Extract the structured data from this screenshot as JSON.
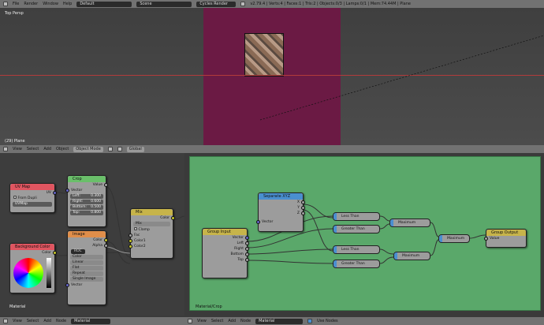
{
  "info_bar": {
    "menus": [
      "File",
      "Render",
      "Window",
      "Help"
    ],
    "layout": "Default",
    "scene": "Scene",
    "engine": "Cycles Render",
    "stats": "v2.79.4 | Verts:4 | Faces:1 | Tris:2 | Objects:0/3 | Lamps:0/1 | Mem:74.44M | Plane"
  },
  "viewport": {
    "view_label": "Top Persp",
    "object_label": "(29) Plane"
  },
  "view3d_header": {
    "menus": [
      "View",
      "Select",
      "Add",
      "Object"
    ],
    "mode": "Object Mode",
    "orientation": "Global"
  },
  "left_editor": {
    "footer": "Material",
    "uvmap": {
      "title": "UV Map",
      "out": "UV",
      "from_dupli": "From Dupli",
      "map": "UVMap"
    },
    "crop": {
      "title": "Crop",
      "out": "Value",
      "vector": "Vector",
      "fields": [
        {
          "k": "Left:",
          "v": "0.300"
        },
        {
          "k": "Right:",
          "v": "0.600"
        },
        {
          "k": "Bottom:",
          "v": "0.500"
        },
        {
          "k": "Top:",
          "v": "0.800"
        }
      ]
    },
    "image": {
      "title": "Image",
      "color": "Color",
      "alpha": "Alpha",
      "img": "ROC",
      "opts": [
        "Color",
        "Linear",
        "Flat",
        "Repeat",
        "Single Image"
      ],
      "vector": "Vector"
    },
    "bg": {
      "title": "Background Color",
      "out": "Color"
    },
    "mix": {
      "title": "Mix",
      "out": "Color",
      "mode": "Mix",
      "clamp": "Clamp",
      "fac": "Fac",
      "c1": "Color1",
      "c2": "Color2"
    }
  },
  "right_editor": {
    "footer": "Material/Crop",
    "sep": {
      "title": "Separate XYZ",
      "x": "X",
      "y": "Y",
      "z": "Z",
      "vector": "Vector"
    },
    "group_input": {
      "title": "Group Input",
      "sockets": [
        "Vector",
        "Left",
        "Right",
        "Bottom",
        "Top"
      ]
    },
    "group_output": {
      "title": "Group Output",
      "value": "Value"
    },
    "mini": [
      "Less Than",
      "Greater Than",
      "Less Than",
      "Greater Than",
      "Maximum",
      "Maximum",
      "Maximum"
    ]
  },
  "node_header_left": {
    "menus": [
      "View",
      "Select",
      "Add",
      "Node"
    ],
    "material": "Material"
  },
  "node_header_right": {
    "menus": [
      "View",
      "Select",
      "Add",
      "Node"
    ],
    "material": "Material",
    "use_nodes": "Use Nodes"
  }
}
